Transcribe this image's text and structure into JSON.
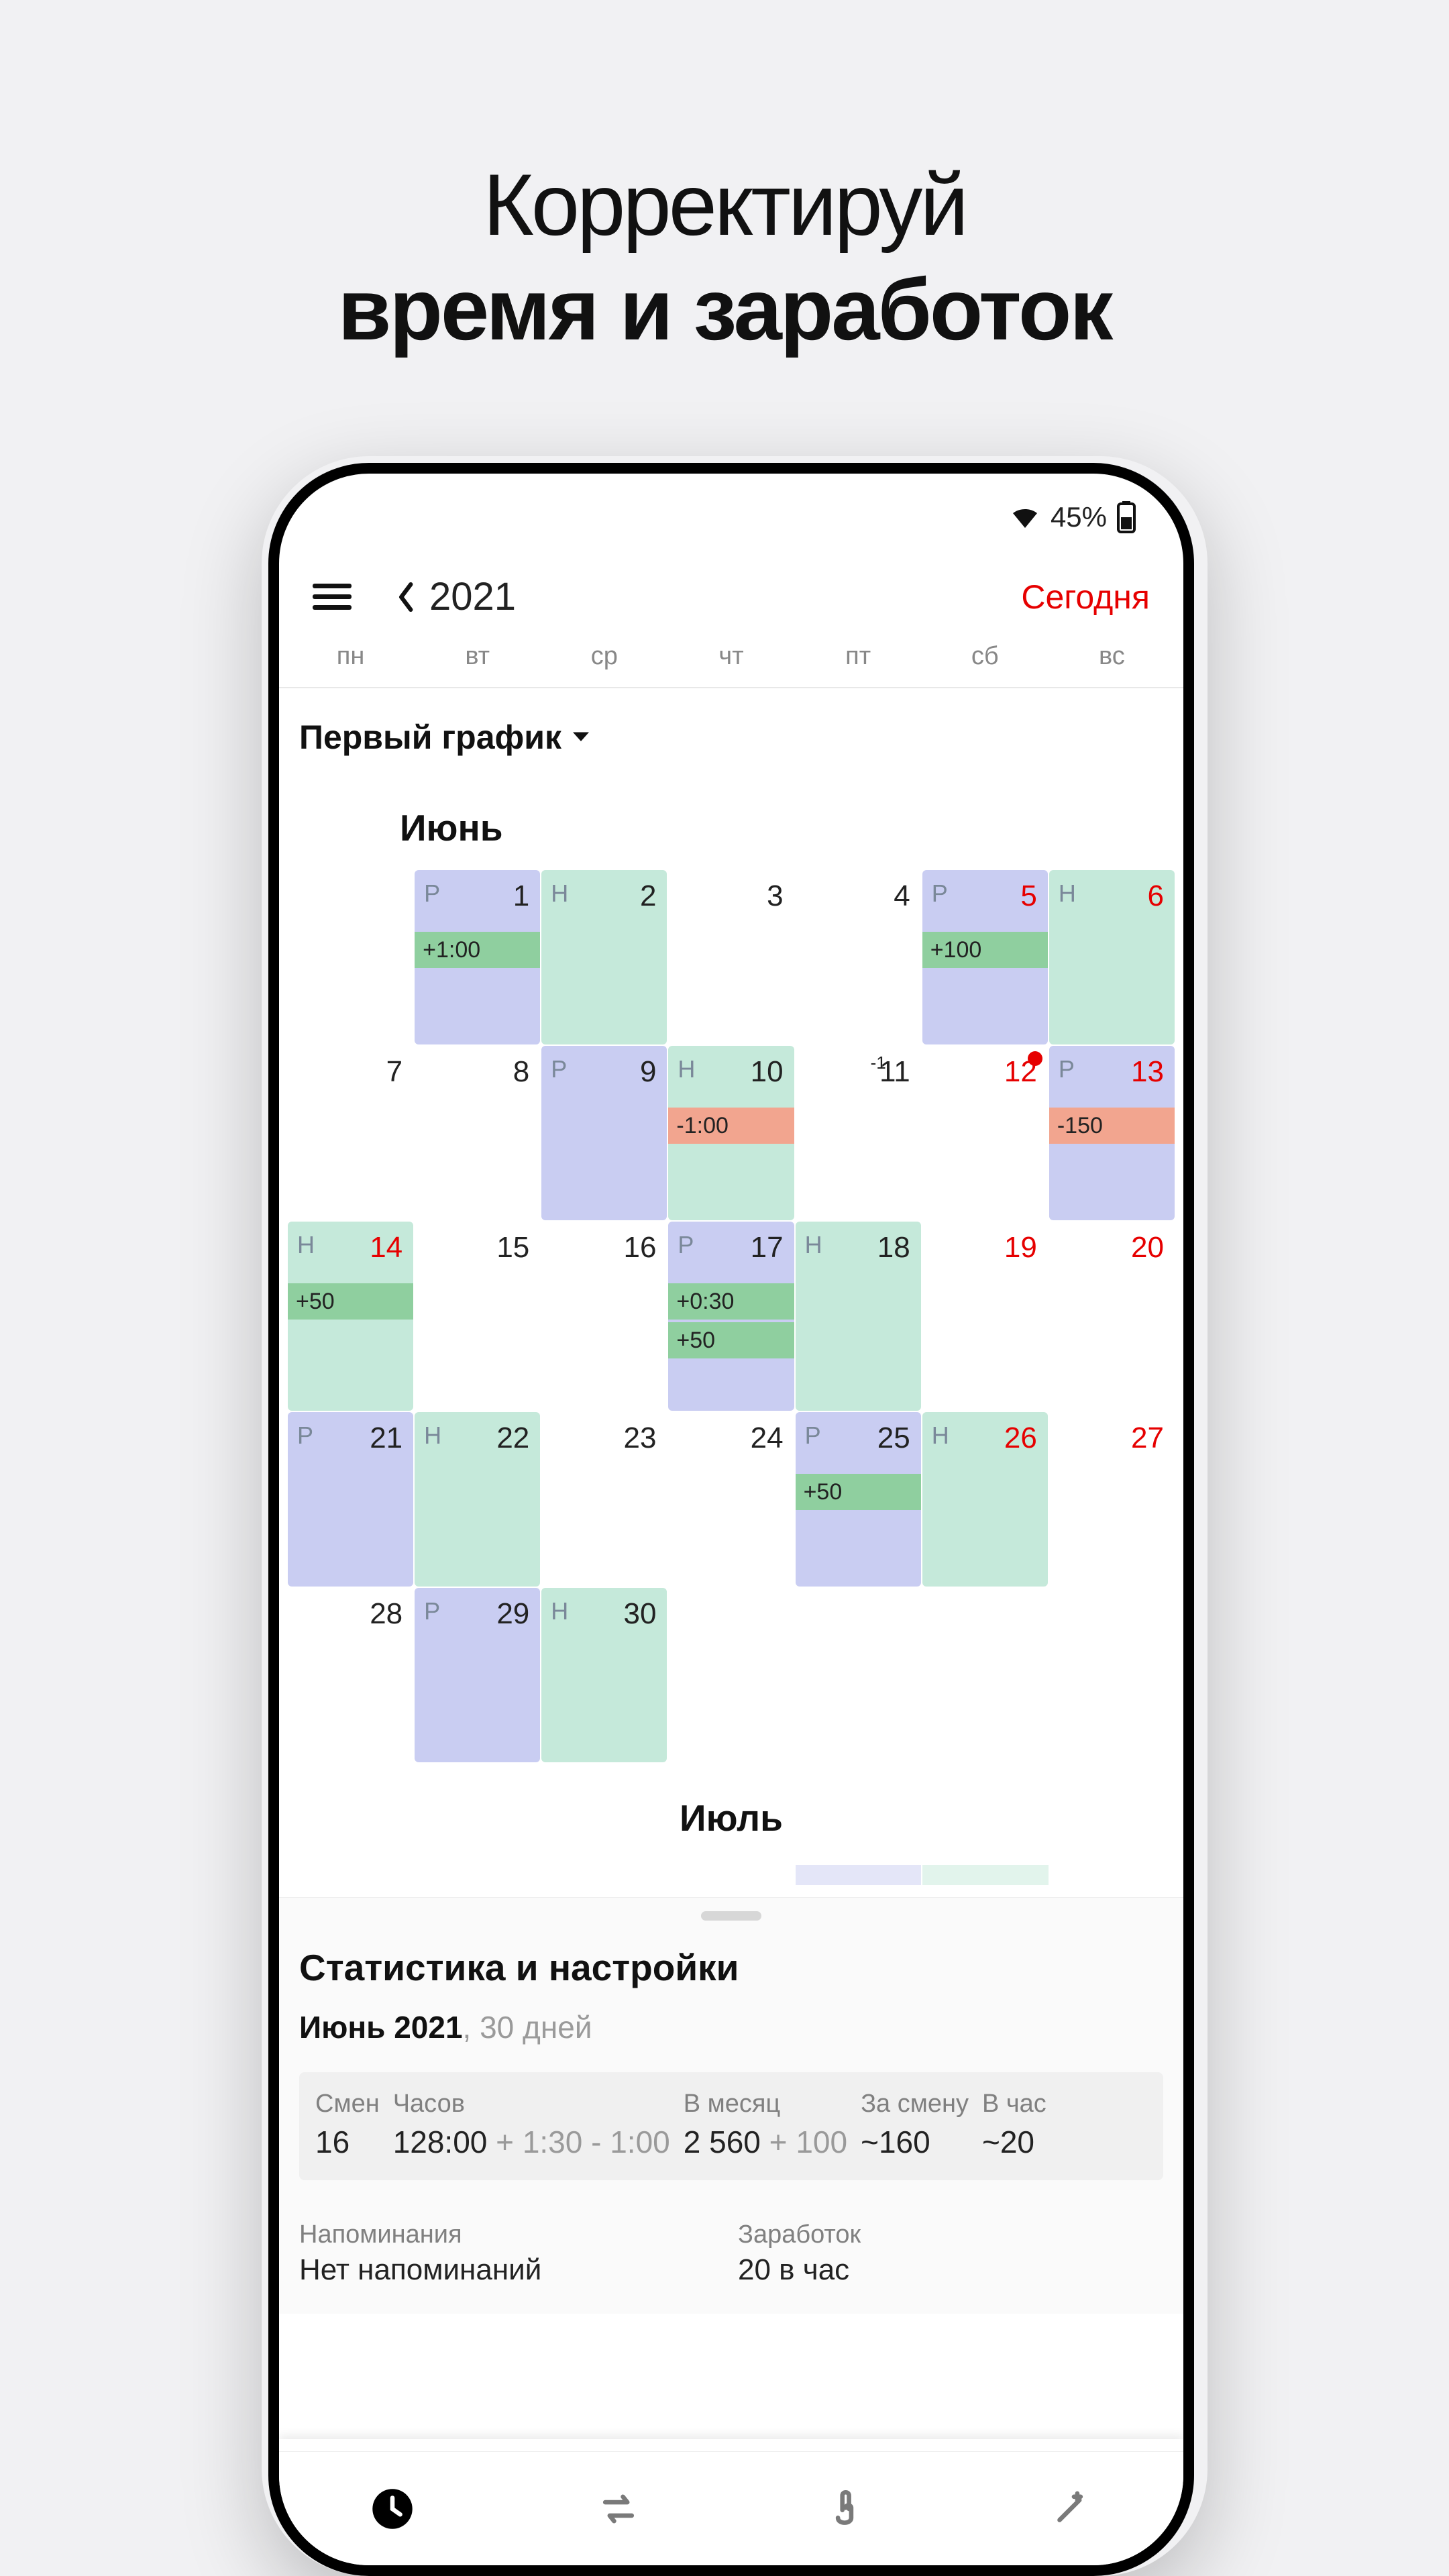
{
  "promo": {
    "line1": "Корректируй",
    "line2": "время и заработок"
  },
  "status": {
    "battery_pct": "45%"
  },
  "header": {
    "year": "2021",
    "today": "Сегодня"
  },
  "dow": [
    "пн",
    "вт",
    "ср",
    "чт",
    "пт",
    "сб",
    "вс"
  ],
  "schedule_selector": "Первый график",
  "month_name": "Июнь",
  "next_month_name": "Июль",
  "calendar": {
    "rows": [
      [
        null,
        {
          "d": "1",
          "kind": "P",
          "chips": [
            {
              "t": "+1:00",
              "tone": "pos"
            }
          ]
        },
        {
          "d": "2",
          "kind": "H"
        },
        {
          "d": "3"
        },
        {
          "d": "4"
        },
        {
          "d": "5",
          "kind": "P",
          "weekend": true,
          "chips": [
            {
              "t": "+100",
              "tone": "pos"
            }
          ]
        },
        {
          "d": "6",
          "kind": "H",
          "weekend": true
        }
      ],
      [
        {
          "d": "7"
        },
        {
          "d": "8"
        },
        {
          "d": "9",
          "kind": "P"
        },
        {
          "d": "10",
          "kind": "H",
          "chips": [
            {
              "t": "-1:00",
              "tone": "neg"
            }
          ]
        },
        {
          "d": "11",
          "sup": "-1"
        },
        {
          "d": "12",
          "weekend": true,
          "dot": true
        },
        {
          "d": "13",
          "kind": "P",
          "weekend": true,
          "chips": [
            {
              "t": "-150",
              "tone": "neg"
            }
          ]
        }
      ],
      [
        {
          "d": "14",
          "kind": "H",
          "weekend": true,
          "chips": [
            {
              "t": "+50",
              "tone": "pos"
            }
          ]
        },
        {
          "d": "15"
        },
        {
          "d": "16"
        },
        {
          "d": "17",
          "kind": "P",
          "chips": [
            {
              "t": "+0:30",
              "tone": "pos"
            },
            {
              "t": "+50",
              "tone": "pos"
            }
          ]
        },
        {
          "d": "18",
          "kind": "H"
        },
        {
          "d": "19",
          "weekend": true
        },
        {
          "d": "20",
          "weekend": true
        }
      ],
      [
        {
          "d": "21",
          "kind": "P"
        },
        {
          "d": "22",
          "kind": "H"
        },
        {
          "d": "23"
        },
        {
          "d": "24"
        },
        {
          "d": "25",
          "kind": "P",
          "chips": [
            {
              "t": "+50",
              "tone": "pos"
            }
          ]
        },
        {
          "d": "26",
          "kind": "H",
          "weekend": true
        },
        {
          "d": "27",
          "weekend": true
        }
      ],
      [
        {
          "d": "28"
        },
        {
          "d": "29",
          "kind": "P"
        },
        {
          "d": "30",
          "kind": "H"
        },
        null,
        null,
        null,
        null
      ]
    ]
  },
  "sheet": {
    "title": "Статистика и настройки",
    "month_label": "Июнь 2021",
    "days_suffix": ", 30 дней",
    "stats": {
      "shifts": {
        "label": "Смен",
        "value": "16"
      },
      "hours": {
        "label": "Часов",
        "value": "128:00",
        "extra": " + 1:30 - 1:00"
      },
      "month_total": {
        "label": "В месяц",
        "value": "2 560",
        "extra": " + 100"
      },
      "per_shift": {
        "label": "За смену",
        "value": "~160"
      },
      "per_hour": {
        "label": "В час",
        "value": "~20"
      }
    },
    "reminders": {
      "label": "Напоминания",
      "value": "Нет напоминаний"
    },
    "earnings": {
      "label": "Заработок",
      "value": "20 в час"
    }
  },
  "july_fade": [
    "",
    "",
    "",
    "",
    "P",
    "H",
    ""
  ],
  "colors": {
    "accent_red": "#e60000",
    "shift_p": "#c9cdf2",
    "shift_h": "#c5e9da",
    "chip_pos": "#8fcf9f",
    "chip_neg": "#f2a58f"
  }
}
